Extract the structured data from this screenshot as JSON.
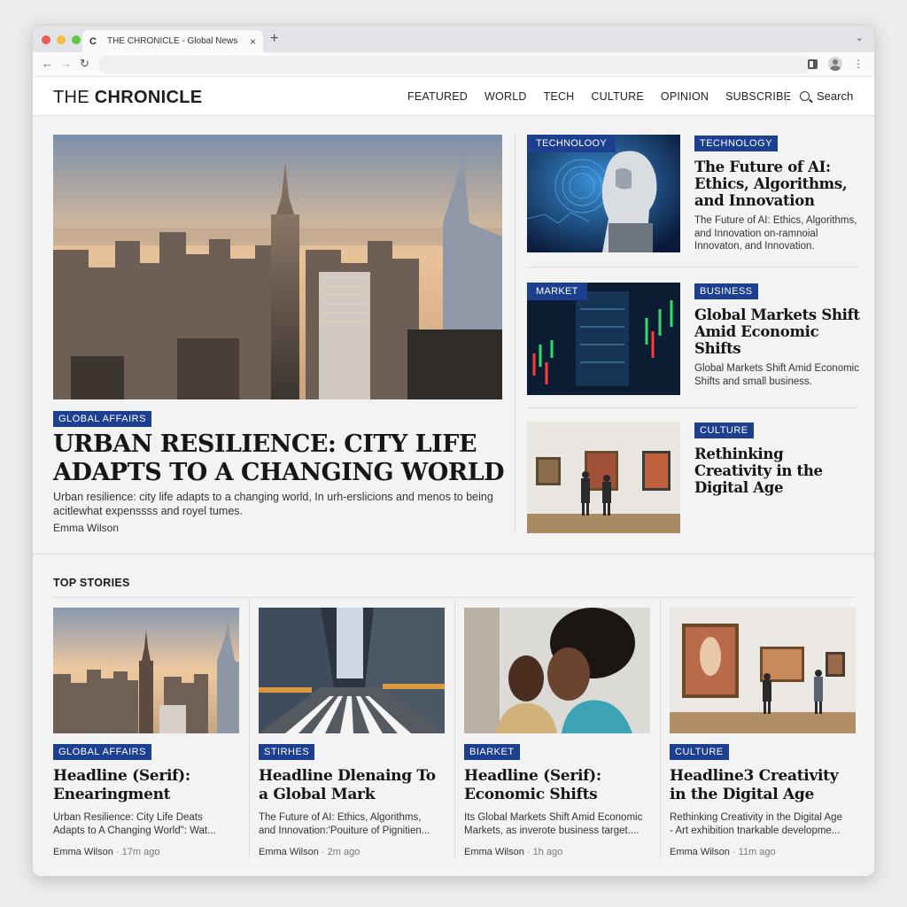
{
  "browser": {
    "tab_title": "THE CHRONICLE - Global News",
    "tab_close": "×",
    "new_tab": "+",
    "tab_menu": "⌄",
    "back": "←",
    "forward": "→",
    "reload": "↻",
    "kebab": "⋮",
    "favicon": "C"
  },
  "site": {
    "logo_light": "THE ",
    "logo_bold": "CHRONICLE",
    "nav": [
      "FEATURED",
      "WORLD",
      "TECH",
      "CULTURE",
      "OPINION",
      "SUBSCRIBE"
    ],
    "search_label": "Search"
  },
  "hero": {
    "badge": "GLOBAL AFFAIRS",
    "title": "URBAN RESILIENCE: CITY LIFE ADAPTS TO A CHANGING WORLD",
    "dek": "Urban resilience: city life adapts to a changing world, In urh-erslicions and menos to being acitlewhat expenssss and royel tumes.",
    "author": "Emma Wilson"
  },
  "side": [
    {
      "overlay": "TECHNOLOOY",
      "badge": "TECHNOLOGY",
      "title": "The Future of AI: Ethics, Algorithms, and Innovation",
      "dek": "The Future of AI: Ethics, Algorithms, and Innovation on-ramnoial Innovaton, and Innovation."
    },
    {
      "overlay": "MARKET",
      "badge": "BUSINESS",
      "title": "Global Markets Shift Amid Economic Shifts",
      "dek": "Global Markets Shift Amid Economic Shifts and small business."
    },
    {
      "overlay": "",
      "badge": "CULTURE",
      "title": "Rethinking Creativity in the Digital Age",
      "dek": ""
    }
  ],
  "top_stories": {
    "label": "TOP STORIES",
    "cards": [
      {
        "badge": "GLOBAL AFFAIRS",
        "title": "Headline (Serif): Enearingment",
        "dek1": "Urban Resilience: City Life Deats",
        "dek2": "Adapts to A Changing World\": Wat...",
        "author": "Emma Wilson",
        "time": "17m ago"
      },
      {
        "badge": "STIRHES",
        "title": "Headline Dlenaing To a Global Mark",
        "dek1": "The Future of AI: Ethics, Algorithms,",
        "dek2": "and Innovation:'Pouiture of Pignitien...",
        "author": "Emma Wilson",
        "time": "2m ago"
      },
      {
        "badge": "BIARKET",
        "title": "Headline (Serif): Economic Shifts",
        "dek1": "Its Global Markets Shift Amid Economic",
        "dek2": "Markets, as inverote business target....",
        "author": "Emma Wilson",
        "time": "1h ago"
      },
      {
        "badge": "CULTURE",
        "title": "Headlinе3 Creativity in the Digital Age",
        "dek1": "Rethinking Creativity in the Digital Age",
        "dek2": "- Art exhibition tnarkable developme...",
        "author": "Emma Wilson",
        "time": "11m ago"
      }
    ],
    "separator": "·"
  },
  "colors": {
    "badge_blue": "#1c3f8f",
    "traffic_red": "#ee5c55",
    "traffic_yellow": "#f4bd40",
    "traffic_green": "#5ec73f"
  }
}
